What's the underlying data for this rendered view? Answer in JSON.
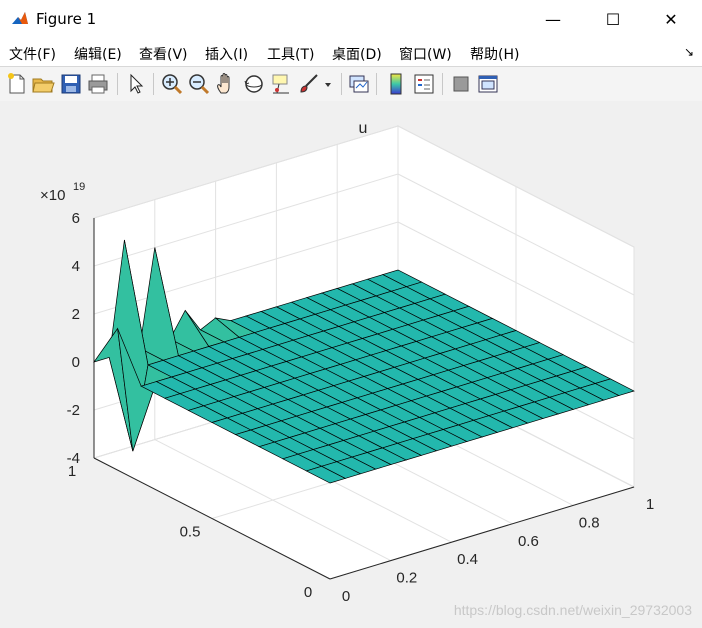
{
  "window": {
    "title": "Figure 1",
    "minimize_glyph": "—",
    "maximize_glyph": "☐",
    "close_glyph": "✕"
  },
  "menu": {
    "items": [
      {
        "label": "文件(F)"
      },
      {
        "label": "编辑(E)"
      },
      {
        "label": "查看(V)"
      },
      {
        "label": "插入(I)"
      },
      {
        "label": "工具(T)"
      },
      {
        "label": "桌面(D)"
      },
      {
        "label": "窗口(W)"
      },
      {
        "label": "帮助(H)"
      }
    ],
    "overflow_glyph": "↘"
  },
  "toolbar": {
    "buttons": [
      "new-figure-icon",
      "open-file-icon",
      "save-icon",
      "print-icon",
      "select-pointer-icon",
      "zoom-in-icon",
      "zoom-out-icon",
      "pan-hand-icon",
      "rotate-3d-icon",
      "data-cursor-icon",
      "brush-icon",
      "brush-dropdown-icon",
      "link-plot-icon",
      "insert-colorbar-icon",
      "insert-legend-icon",
      "hide-plot-tools-icon",
      "show-plot-tools-icon"
    ]
  },
  "chart_data": {
    "type": "surface",
    "title": "u",
    "exponent_label": "×10",
    "exponent_value": "19",
    "zlim": [
      -4,
      6
    ],
    "zticks": [
      "6",
      "4",
      "2",
      "0",
      "-2",
      "-4"
    ],
    "xticks": [
      "0",
      "0.2",
      "0.4",
      "0.6",
      "0.8",
      "1"
    ],
    "yticks": [
      "0",
      "0.5",
      "1"
    ],
    "grid": true,
    "surface_color": "#23b8ad",
    "edge_color": "#000000",
    "description_values": {
      "spike_1_peak_e19": 1.9,
      "spike_1_trough_e19": -3.4,
      "spike_2_peak_e19": 4.7,
      "spike_3_peak_e19": 4.0,
      "spike_4_peak_e19": 1.0,
      "spike_5_peak_e19": 0.3
    }
  },
  "watermark": "https://blog.csdn.net/weixin_29732003"
}
